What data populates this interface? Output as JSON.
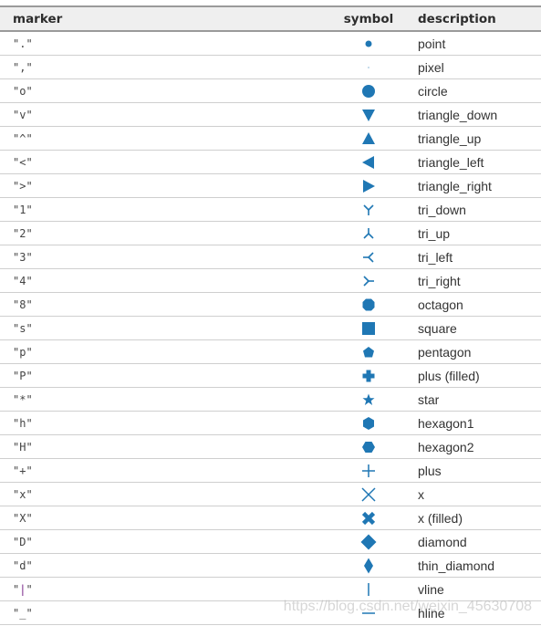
{
  "table": {
    "headers": {
      "marker": "marker",
      "symbol": "symbol",
      "description": "description"
    },
    "symbol_color": "#1f77b4",
    "rows": [
      {
        "marker": "\".\"",
        "symbol": "point-icon",
        "description": "point"
      },
      {
        "marker": "\",\"",
        "symbol": "pixel-icon",
        "description": "pixel"
      },
      {
        "marker": "\"o\"",
        "symbol": "circle-icon",
        "description": "circle"
      },
      {
        "marker": "\"v\"",
        "symbol": "triangle-down-icon",
        "description": "triangle_down"
      },
      {
        "marker": "\"^\"",
        "symbol": "triangle-up-icon",
        "description": "triangle_up"
      },
      {
        "marker": "\"<\"",
        "symbol": "triangle-left-icon",
        "description": "triangle_left"
      },
      {
        "marker": "\">\"",
        "symbol": "triangle-right-icon",
        "description": "triangle_right"
      },
      {
        "marker": "\"1\"",
        "symbol": "tri-down-icon",
        "description": "tri_down"
      },
      {
        "marker": "\"2\"",
        "symbol": "tri-up-icon",
        "description": "tri_up"
      },
      {
        "marker": "\"3\"",
        "symbol": "tri-left-icon",
        "description": "tri_left"
      },
      {
        "marker": "\"4\"",
        "symbol": "tri-right-icon",
        "description": "tri_right"
      },
      {
        "marker": "\"8\"",
        "symbol": "octagon-icon",
        "description": "octagon"
      },
      {
        "marker": "\"s\"",
        "symbol": "square-icon",
        "description": "square"
      },
      {
        "marker": "\"p\"",
        "symbol": "pentagon-icon",
        "description": "pentagon"
      },
      {
        "marker": "\"P\"",
        "symbol": "plus-filled-icon",
        "description": "plus (filled)"
      },
      {
        "marker": "\"*\"",
        "symbol": "star-icon",
        "description": "star"
      },
      {
        "marker": "\"h\"",
        "symbol": "hexagon1-icon",
        "description": "hexagon1"
      },
      {
        "marker": "\"H\"",
        "symbol": "hexagon2-icon",
        "description": "hexagon2"
      },
      {
        "marker": "\"+\"",
        "symbol": "plus-icon",
        "description": "plus"
      },
      {
        "marker": "\"x\"",
        "symbol": "x-icon",
        "description": "x"
      },
      {
        "marker": "\"X\"",
        "symbol": "x-filled-icon",
        "description": "x (filled)"
      },
      {
        "marker": "\"D\"",
        "symbol": "diamond-icon",
        "description": "diamond"
      },
      {
        "marker": "\"d\"",
        "symbol": "thin-diamond-icon",
        "description": "thin_diamond"
      },
      {
        "marker": "\"|\"",
        "symbol": "vline-icon",
        "description": "vline"
      },
      {
        "marker": "\"_\"",
        "symbol": "hline-icon",
        "description": "hline"
      }
    ]
  },
  "watermark": "https://blog.csdn.net/weixin_45630708"
}
